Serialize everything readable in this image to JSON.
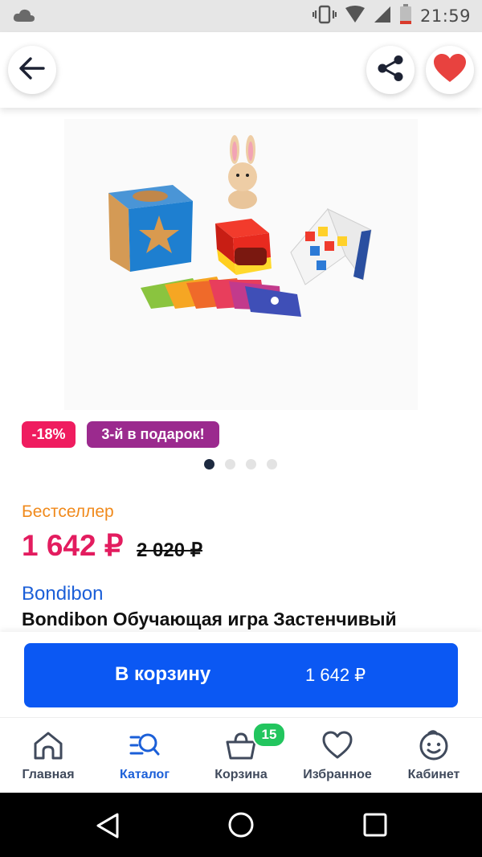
{
  "status_bar": {
    "time": "21:59"
  },
  "header": {
    "back_icon": "arrow-left-icon",
    "share_icon": "share-icon",
    "favorite_icon": "heart-icon",
    "favorite_color": "#e8423f"
  },
  "gallery": {
    "total_images": 4,
    "active_index": 0
  },
  "badges": {
    "discount": "-18%",
    "promo": "3-й в подарок!",
    "discount_color": "#ef1c5f",
    "promo_color": "#9b2a8e"
  },
  "product": {
    "label": "Бестселлер",
    "price": "1 642 ₽",
    "old_price": "2 020 ₽",
    "brand": "Bondibon",
    "title": "Bondibon Обучающая игра Застенчивый"
  },
  "cart_button": {
    "label": "В корзину",
    "amount": "1 642 ₽",
    "color": "#0b58f3"
  },
  "bottom_nav": {
    "items": [
      {
        "label": "Главная",
        "icon": "home-icon"
      },
      {
        "label": "Каталог",
        "icon": "catalog-search-icon"
      },
      {
        "label": "Корзина",
        "icon": "basket-icon"
      },
      {
        "label": "Избранное",
        "icon": "heart-outline-icon"
      },
      {
        "label": "Кабинет",
        "icon": "smiley-icon"
      }
    ],
    "active": "Каталог",
    "cart_count": "15"
  }
}
